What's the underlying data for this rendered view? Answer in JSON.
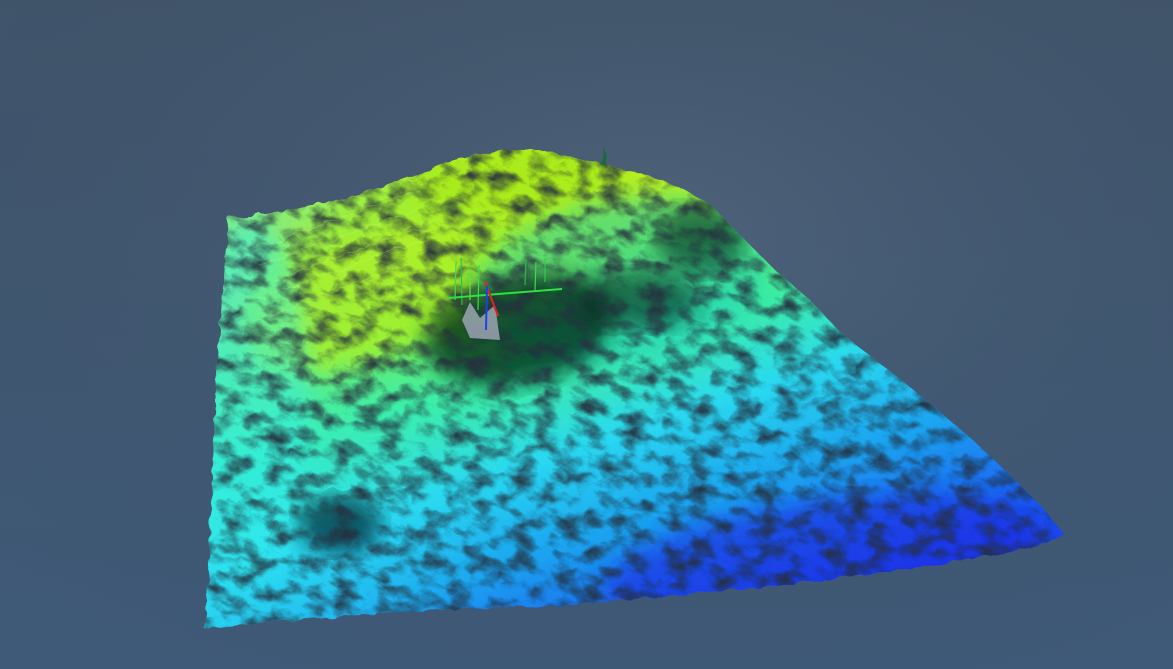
{
  "viewer": {
    "background": {
      "top_color": "#40546a",
      "bottom_color": "#3f5a78"
    },
    "terrain": {
      "colormap": [
        "#1d23e6",
        "#1a55f0",
        "#1aa2f0",
        "#2ad9f0",
        "#3ef09a",
        "#7ef03a",
        "#c6f020"
      ],
      "shading_color": "#05070a"
    },
    "axes_gizmo": {
      "x_color": "#e62020",
      "y_color": "#30e040",
      "z_color": "#2040f0"
    }
  }
}
